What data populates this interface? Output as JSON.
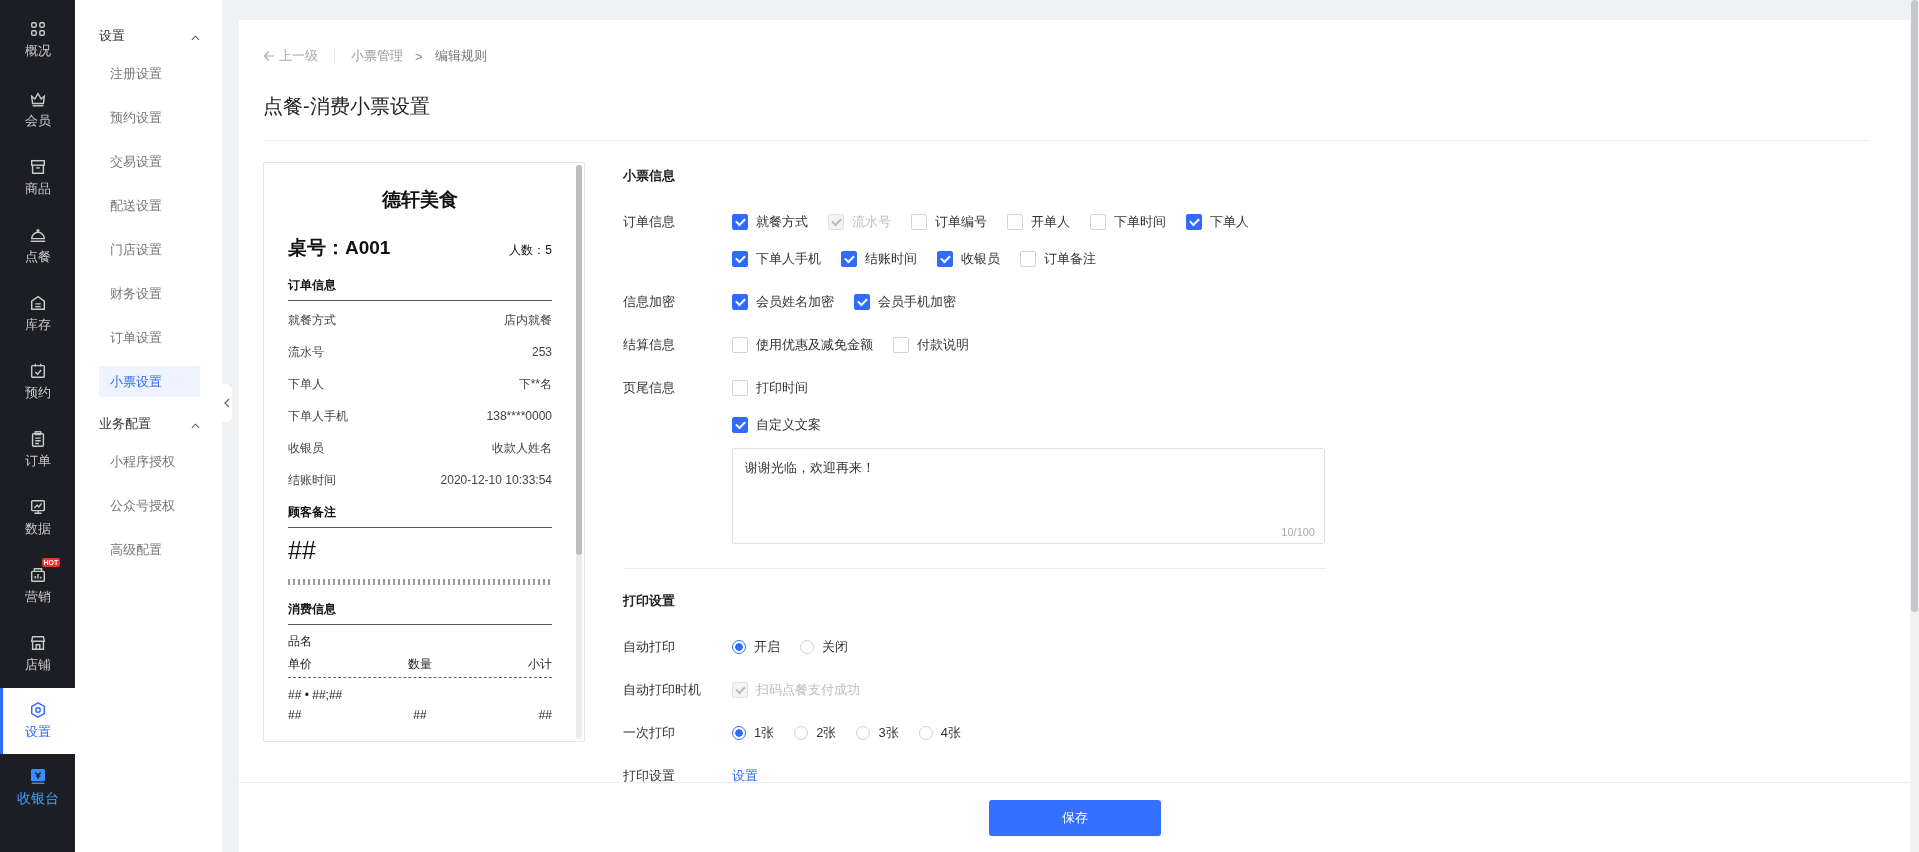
{
  "nav": {
    "items": [
      {
        "label": "概况",
        "kind": "module",
        "selected": false
      },
      {
        "label": "会员",
        "kind": "module",
        "selected": false
      },
      {
        "label": "商品",
        "kind": "module",
        "selected": false
      },
      {
        "label": "点餐",
        "kind": "module",
        "selected": false
      },
      {
        "label": "库存",
        "kind": "module",
        "selected": false
      },
      {
        "label": "预约",
        "kind": "module",
        "selected": false
      },
      {
        "label": "订单",
        "kind": "module",
        "selected": false
      },
      {
        "label": "数据",
        "kind": "module",
        "selected": false
      },
      {
        "label": "营销",
        "kind": "module",
        "selected": false,
        "badge": "HOT"
      },
      {
        "label": "店铺",
        "kind": "module",
        "selected": false
      },
      {
        "label": "设置",
        "kind": "module",
        "selected": true
      },
      {
        "label": "收银台",
        "kind": "cashier",
        "selected": false
      }
    ]
  },
  "submenu": {
    "groups": [
      {
        "title": "设置",
        "expanded": true,
        "items": [
          {
            "label": "注册设置",
            "selected": false
          },
          {
            "label": "预约设置",
            "selected": false
          },
          {
            "label": "交易设置",
            "selected": false
          },
          {
            "label": "配送设置",
            "selected": false
          },
          {
            "label": "门店设置",
            "selected": false
          },
          {
            "label": "财务设置",
            "selected": false
          },
          {
            "label": "订单设置",
            "selected": false
          },
          {
            "label": "小票设置",
            "selected": true
          }
        ]
      },
      {
        "title": "业务配置",
        "expanded": true,
        "items": [
          {
            "label": "小程序授权",
            "selected": false
          },
          {
            "label": "公众号授权",
            "selected": false
          },
          {
            "label": "高级配置",
            "selected": false
          }
        ]
      }
    ]
  },
  "breadcrumb": {
    "back": "上一级",
    "path": [
      "小票管理",
      "编辑规则"
    ],
    "separator": ">"
  },
  "title": "点餐-消费小票设置",
  "receipt": {
    "shop_name": "德轩美食",
    "table": "桌号：A001",
    "guests": "人数：5",
    "order_info": {
      "title": "订单信息",
      "rows": [
        {
          "label": "就餐方式",
          "value": "店内就餐"
        },
        {
          "label": "流水号",
          "value": "253"
        },
        {
          "label": "下单人",
          "value": "下**名"
        },
        {
          "label": "下单人手机",
          "value": "138****0000"
        },
        {
          "label": "收银员",
          "value": "收款人姓名"
        },
        {
          "label": "结账时间",
          "value": "2020-12-10 10:33:54"
        }
      ]
    },
    "note": {
      "title": "顾客备注",
      "text": "##"
    },
    "consumption": {
      "title": "消费信息",
      "item_header": "品名",
      "columns": [
        "单价",
        "数量",
        "小计"
      ],
      "item_line": "## • ##;##",
      "item_values": [
        "##",
        "##",
        "##"
      ]
    }
  },
  "form": {
    "sections": [
      {
        "title": "小票信息",
        "rows": [
          {
            "label": "订单信息",
            "kind": "checkboxes",
            "lines": [
              [
                {
                  "label": "就餐方式",
                  "checked": true,
                  "disabled": false
                },
                {
                  "label": "流水号",
                  "checked": true,
                  "disabled": true
                },
                {
                  "label": "订单编号",
                  "checked": false,
                  "disabled": false
                },
                {
                  "label": "开单人",
                  "checked": false,
                  "disabled": false
                },
                {
                  "label": "下单时间",
                  "checked": false,
                  "disabled": false
                },
                {
                  "label": "下单人",
                  "checked": true,
                  "disabled": false
                }
              ],
              [
                {
                  "label": "下单人手机",
                  "checked": true,
                  "disabled": false
                },
                {
                  "label": "结账时间",
                  "checked": true,
                  "disabled": false
                },
                {
                  "label": "收银员",
                  "checked": true,
                  "disabled": false
                },
                {
                  "label": "订单备注",
                  "checked": false,
                  "disabled": false
                }
              ]
            ]
          },
          {
            "label": "信息加密",
            "kind": "checkboxes",
            "lines": [
              [
                {
                  "label": "会员姓名加密",
                  "checked": true,
                  "disabled": false
                },
                {
                  "label": "会员手机加密",
                  "checked": true,
                  "disabled": false
                }
              ]
            ]
          },
          {
            "label": "结算信息",
            "kind": "checkboxes",
            "lines": [
              [
                {
                  "label": "使用优惠及减免金额",
                  "checked": false,
                  "disabled": false
                },
                {
                  "label": "付款说明",
                  "checked": false,
                  "disabled": false
                }
              ]
            ]
          },
          {
            "label": "页尾信息",
            "kind": "checkboxes",
            "lines": [
              [
                {
                  "label": "打印时间",
                  "checked": false,
                  "disabled": false
                }
              ],
              [
                {
                  "label": "自定义文案",
                  "checked": true,
                  "disabled": false
                }
              ]
            ],
            "textarea": {
              "value": "谢谢光临，欢迎再来！",
              "counter": "10/100"
            }
          }
        ]
      },
      {
        "title": "打印设置",
        "rows": [
          {
            "label": "自动打印",
            "kind": "radios",
            "options": [
              {
                "label": "开启",
                "selected": true
              },
              {
                "label": "关闭",
                "selected": false
              }
            ]
          },
          {
            "label": "自动打印时机",
            "kind": "checkboxes",
            "lines": [
              [
                {
                  "label": "扫码点餐支付成功",
                  "checked": true,
                  "disabled": true
                }
              ]
            ]
          },
          {
            "label": "一次打印",
            "kind": "radios",
            "options": [
              {
                "label": "1张",
                "selected": true
              },
              {
                "label": "2张",
                "selected": false
              },
              {
                "label": "3张",
                "selected": false
              },
              {
                "label": "4张",
                "selected": false
              }
            ]
          },
          {
            "label": "打印设置",
            "kind": "link",
            "link": "设置"
          }
        ]
      }
    ]
  },
  "footer": {
    "save": "保存"
  }
}
